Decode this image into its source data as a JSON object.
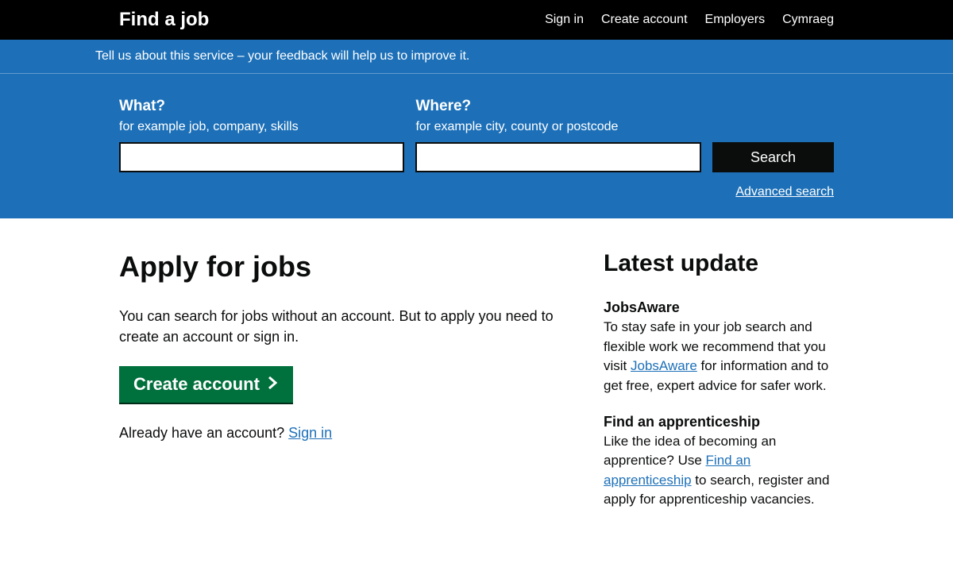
{
  "header": {
    "site_title": "Find a job",
    "nav": [
      "Sign in",
      "Create account",
      "Employers",
      "Cymraeg"
    ]
  },
  "phase_banner": {
    "prefix": "Tell us about this service – your ",
    "link": "feedback",
    "suffix": " will help us to improve it."
  },
  "search": {
    "what_label": "What?",
    "what_hint": "for example job, company, skills",
    "what_value": "",
    "where_label": "Where?",
    "where_hint": "for example city, county or postcode",
    "where_value": "",
    "button": "Search",
    "advanced": "Advanced search"
  },
  "apply": {
    "heading": "Apply for jobs",
    "body": "You can search for jobs without an account. But to apply you need to create an account or sign in.",
    "create_button": "Create account",
    "already_prefix": "Already have an account? ",
    "signin_link": "Sign in"
  },
  "updates": {
    "heading": "Latest update",
    "items": [
      {
        "title": "JobsAware",
        "pre": "To stay safe in your job search and flexible work we recommend that you visit ",
        "link": "JobsAware",
        "post": " for information and to get free, expert advice for safer work."
      },
      {
        "title": "Find an apprenticeship",
        "pre": "Like the idea of becoming an apprentice? Use ",
        "link": "Find an apprenticeship",
        "post": " to search, register and apply for apprenticeship vacancies."
      }
    ]
  }
}
